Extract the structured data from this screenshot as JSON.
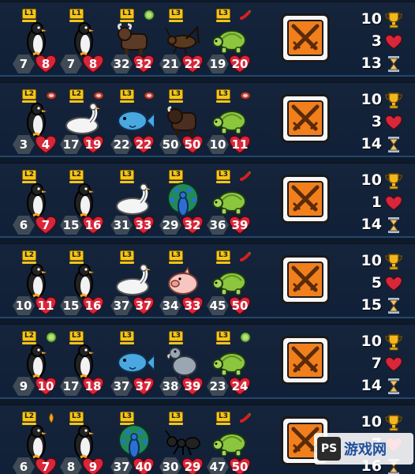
{
  "colors": {
    "background": "#0e1a2a",
    "row_border": "#24476c",
    "level_badge": "#f5c518",
    "attack_hex": "#3f4a55",
    "health_heart": "#d8263a",
    "battle_orange": "#f07f1c",
    "trophy": "#f2b51e",
    "hourglass": "#f0c46a"
  },
  "rows": [
    {
      "pets": [
        {
          "animal": "penguin",
          "level": "1",
          "held": "",
          "attack": "7",
          "health": "8"
        },
        {
          "animal": "penguin",
          "level": "1",
          "held": "",
          "attack": "7",
          "health": "8"
        },
        {
          "animal": "ox",
          "level": "1",
          "held": "melon",
          "attack": "32",
          "health": "32"
        },
        {
          "animal": "cricket",
          "level": "3",
          "held": "",
          "attack": "21",
          "health": "22"
        },
        {
          "animal": "turtle",
          "level": "3",
          "held": "chili",
          "attack": "19",
          "health": "20"
        }
      ],
      "wins": "10",
      "lives": "3",
      "turn": "13"
    },
    {
      "pets": [
        {
          "animal": "penguin",
          "level": "2",
          "held": "steak",
          "attack": "3",
          "health": "4"
        },
        {
          "animal": "swan",
          "level": "2",
          "held": "steak",
          "attack": "17",
          "health": "19"
        },
        {
          "animal": "fish",
          "level": "3",
          "held": "steak",
          "attack": "22",
          "health": "22"
        },
        {
          "animal": "bison",
          "level": "3",
          "held": "",
          "attack": "50",
          "health": "50"
        },
        {
          "animal": "turtle",
          "level": "3",
          "held": "steak",
          "attack": "10",
          "health": "11"
        }
      ],
      "wins": "10",
      "lives": "3",
      "turn": "14"
    },
    {
      "pets": [
        {
          "animal": "penguin",
          "level": "2",
          "held": "",
          "attack": "6",
          "health": "7"
        },
        {
          "animal": "penguin",
          "level": "2",
          "held": "",
          "attack": "15",
          "health": "16"
        },
        {
          "animal": "swan",
          "level": "3",
          "held": "",
          "attack": "31",
          "health": "33"
        },
        {
          "animal": "peacock",
          "level": "3",
          "held": "",
          "attack": "29",
          "health": "32"
        },
        {
          "animal": "turtle",
          "level": "3",
          "held": "chili",
          "attack": "36",
          "health": "39"
        }
      ],
      "wins": "10",
      "lives": "1",
      "turn": "14"
    },
    {
      "pets": [
        {
          "animal": "penguin",
          "level": "2",
          "held": "",
          "attack": "10",
          "health": "11"
        },
        {
          "animal": "penguin",
          "level": "3",
          "held": "",
          "attack": "15",
          "health": "16"
        },
        {
          "animal": "swan",
          "level": "3",
          "held": "",
          "attack": "37",
          "health": "37"
        },
        {
          "animal": "pig",
          "level": "3",
          "held": "",
          "attack": "34",
          "health": "33"
        },
        {
          "animal": "turtle",
          "level": "3",
          "held": "chili",
          "attack": "45",
          "health": "50"
        }
      ],
      "wins": "10",
      "lives": "5",
      "turn": "15"
    },
    {
      "pets": [
        {
          "animal": "penguin",
          "level": "2",
          "held": "melon",
          "attack": "9",
          "health": "10"
        },
        {
          "animal": "penguin",
          "level": "3",
          "held": "",
          "attack": "17",
          "health": "18"
        },
        {
          "animal": "fish",
          "level": "3",
          "held": "",
          "attack": "37",
          "health": "37"
        },
        {
          "animal": "dodo",
          "level": "3",
          "held": "",
          "attack": "38",
          "health": "39"
        },
        {
          "animal": "turtle",
          "level": "3",
          "held": "melon",
          "attack": "23",
          "health": "24"
        }
      ],
      "wins": "10",
      "lives": "7",
      "turn": "14"
    },
    {
      "pets": [
        {
          "animal": "penguin",
          "level": "2",
          "held": "honey",
          "attack": "6",
          "health": "7"
        },
        {
          "animal": "penguin",
          "level": "3",
          "held": "",
          "attack": "8",
          "health": "9"
        },
        {
          "animal": "peacock",
          "level": "3",
          "held": "",
          "attack": "37",
          "health": "40"
        },
        {
          "animal": "ant",
          "level": "3",
          "held": "",
          "attack": "30",
          "health": "29"
        },
        {
          "animal": "turtle",
          "level": "3",
          "held": "chili",
          "attack": "47",
          "health": "50"
        }
      ],
      "wins": "10",
      "lives": "7",
      "turn": "16"
    }
  ],
  "watermark": {
    "logo": "PS",
    "text": "游戏网"
  }
}
